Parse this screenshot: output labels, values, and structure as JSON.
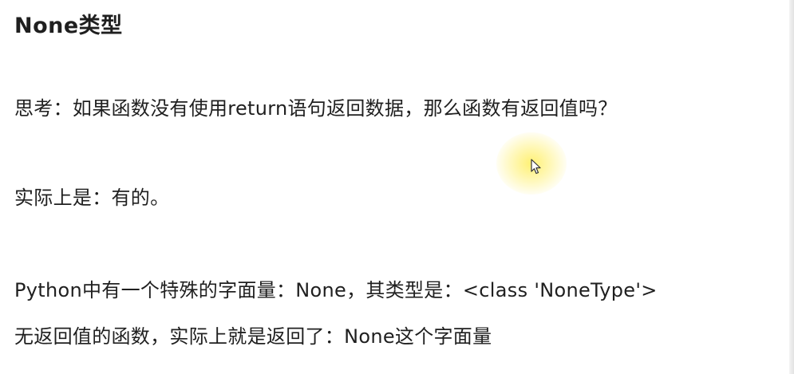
{
  "heading": "None类型",
  "paragraphs": [
    "思考：如果函数没有使用return语句返回数据，那么函数有返回值吗？",
    "实际上是：有的。",
    "Python中有一个特殊的字面量：None，其类型是：<class 'NoneType'>",
    "无返回值的函数，实际上就是返回了：None这个字面量"
  ],
  "cursor": {
    "icon": "mouse-pointer-icon"
  }
}
